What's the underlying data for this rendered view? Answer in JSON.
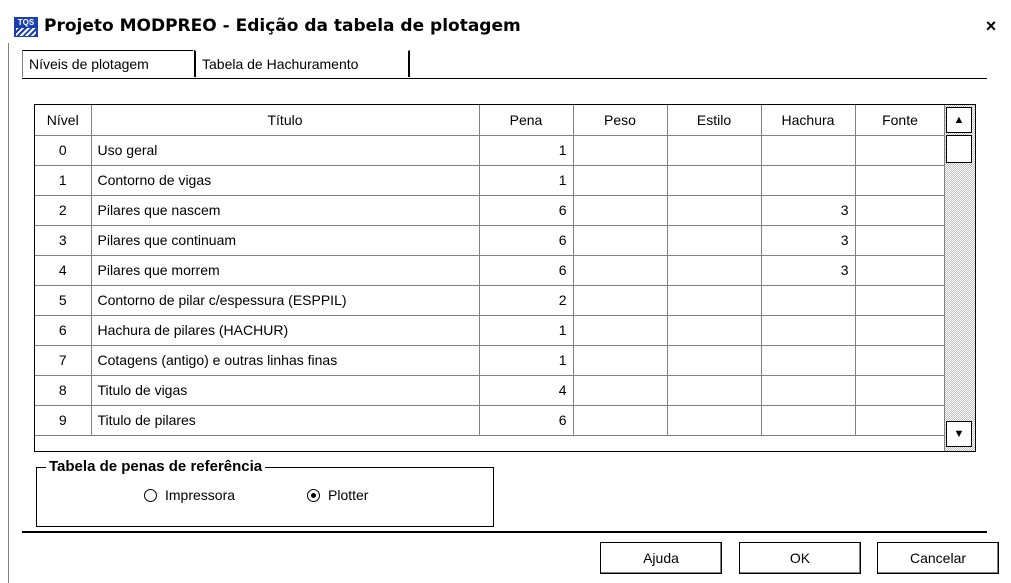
{
  "window": {
    "title": "Projeto MODPREO - Edição da tabela de plotagem",
    "close_glyph": "×",
    "app_icon_label": "TQS"
  },
  "tabs": [
    {
      "label": "Níveis de plotagem",
      "active": true
    },
    {
      "label": "Tabela de Hachuramento",
      "active": false
    }
  ],
  "grid": {
    "columns": [
      "Nível",
      "Título",
      "Pena",
      "Peso",
      "Estilo",
      "Hachura",
      "Fonte"
    ],
    "rows": [
      {
        "nivel": "0",
        "titulo": "Uso geral",
        "pena": "1",
        "peso": "",
        "estilo": "",
        "hachura": "",
        "fonte": ""
      },
      {
        "nivel": "1",
        "titulo": "Contorno de vigas",
        "pena": "1",
        "peso": "",
        "estilo": "",
        "hachura": "",
        "fonte": ""
      },
      {
        "nivel": "2",
        "titulo": "Pilares que nascem",
        "pena": "6",
        "peso": "",
        "estilo": "",
        "hachura": "3",
        "fonte": ""
      },
      {
        "nivel": "3",
        "titulo": "Pilares que continuam",
        "pena": "6",
        "peso": "",
        "estilo": "",
        "hachura": "3",
        "fonte": ""
      },
      {
        "nivel": "4",
        "titulo": "Pilares que morrem",
        "pena": "6",
        "peso": "",
        "estilo": "",
        "hachura": "3",
        "fonte": ""
      },
      {
        "nivel": "5",
        "titulo": "Contorno de pilar c/espessura (ESPPIL)",
        "pena": "2",
        "peso": "",
        "estilo": "",
        "hachura": "",
        "fonte": ""
      },
      {
        "nivel": "6",
        "titulo": "Hachura de pilares (HACHUR)",
        "pena": "1",
        "peso": "",
        "estilo": "",
        "hachura": "",
        "fonte": ""
      },
      {
        "nivel": "7",
        "titulo": "Cotagens (antigo) e outras linhas finas",
        "pena": "1",
        "peso": "",
        "estilo": "",
        "hachura": "",
        "fonte": ""
      },
      {
        "nivel": "8",
        "titulo": "Titulo de vigas",
        "pena": "4",
        "peso": "",
        "estilo": "",
        "hachura": "",
        "fonte": ""
      },
      {
        "nivel": "9",
        "titulo": "Titulo de pilares",
        "pena": "6",
        "peso": "",
        "estilo": "",
        "hachura": "",
        "fonte": ""
      }
    ],
    "scroll_up_glyph": "▲",
    "scroll_down_glyph": "▼"
  },
  "pen_table": {
    "legend": "Tabela de penas de referência",
    "options": [
      {
        "label": "Impressora",
        "selected": false
      },
      {
        "label": "Plotter",
        "selected": true
      }
    ]
  },
  "buttons": {
    "help": "Ajuda",
    "ok": "OK",
    "cancel": "Cancelar"
  },
  "colors": {
    "icon_bg": "#1a3fb0",
    "grid_lines": "#808080",
    "scroll_track": "#c0c0c0"
  }
}
